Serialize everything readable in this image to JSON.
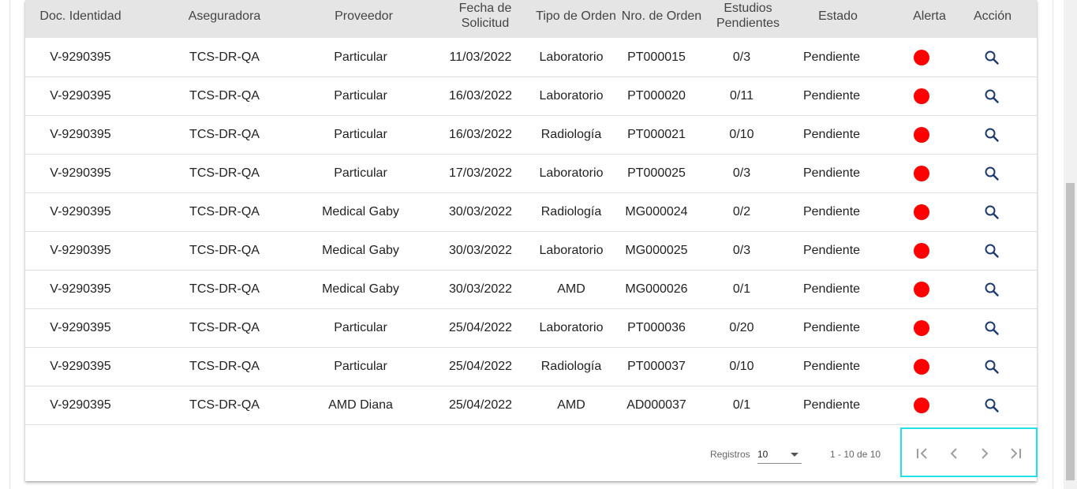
{
  "table": {
    "headers": [
      "Doc. Identidad",
      "Aseguradora",
      "Proveedor",
      "Fecha de Solicitud",
      "Tipo de Orden",
      "Nro. de Orden",
      "Estudios Pendientes",
      "Estado",
      "Alerta",
      "Acción"
    ],
    "rows": [
      [
        "V-9290395",
        "TCS-DR-QA",
        "Particular",
        "11/03/2022",
        "Laboratorio",
        "PT000015",
        "0/3",
        "Pendiente"
      ],
      [
        "V-9290395",
        "TCS-DR-QA",
        "Particular",
        "16/03/2022",
        "Laboratorio",
        "PT000020",
        "0/11",
        "Pendiente"
      ],
      [
        "V-9290395",
        "TCS-DR-QA",
        "Particular",
        "16/03/2022",
        "Radiología",
        "PT000021",
        "0/10",
        "Pendiente"
      ],
      [
        "V-9290395",
        "TCS-DR-QA",
        "Particular",
        "17/03/2022",
        "Laboratorio",
        "PT000025",
        "0/3",
        "Pendiente"
      ],
      [
        "V-9290395",
        "TCS-DR-QA",
        "Medical Gaby",
        "30/03/2022",
        "Radiología",
        "MG000024",
        "0/2",
        "Pendiente"
      ],
      [
        "V-9290395",
        "TCS-DR-QA",
        "Medical Gaby",
        "30/03/2022",
        "Laboratorio",
        "MG000025",
        "0/3",
        "Pendiente"
      ],
      [
        "V-9290395",
        "TCS-DR-QA",
        "Medical Gaby",
        "30/03/2022",
        "AMD",
        "MG000026",
        "0/1",
        "Pendiente"
      ],
      [
        "V-9290395",
        "TCS-DR-QA",
        "Particular",
        "25/04/2022",
        "Laboratorio",
        "PT000036",
        "0/20",
        "Pendiente"
      ],
      [
        "V-9290395",
        "TCS-DR-QA",
        "Particular",
        "25/04/2022",
        "Radiología",
        "PT000037",
        "0/10",
        "Pendiente"
      ],
      [
        "V-9290395",
        "TCS-DR-QA",
        "AMD Diana",
        "25/04/2022",
        "AMD",
        "AD000037",
        "0/1",
        "Pendiente"
      ]
    ],
    "alert_color": "#ff0000",
    "action_icon": "search-icon"
  },
  "pagination": {
    "registros_label": "Registros",
    "page_size": "10",
    "range_text": "1 - 10 de 10",
    "icons": [
      "first-page-icon",
      "previous-page-icon",
      "next-page-icon",
      "last-page-icon"
    ],
    "highlight_color": "#22e0e6"
  }
}
